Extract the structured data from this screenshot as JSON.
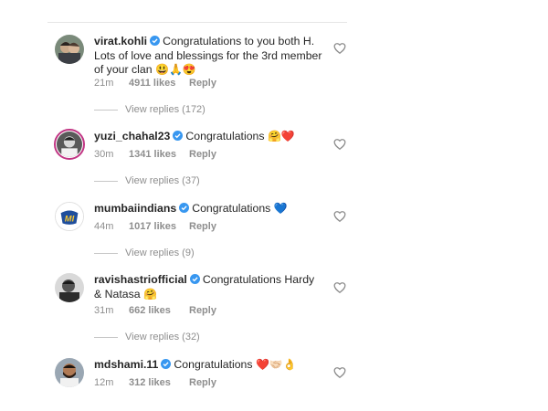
{
  "colors": {
    "accent_verified": "#3897f0",
    "muted": "#8e8e8e",
    "heart_red": "#ed4956",
    "story_ring": "#c13584"
  },
  "comments": [
    {
      "username": "virat.kohli",
      "text": "Congratulations to you both H. Lots of love and blessings for the 3rd member of your clan",
      "emojis": "😃🙏😍",
      "time": "21m",
      "likes": "4911 likes",
      "reply": "Reply",
      "view_replies": "View replies (172)"
    },
    {
      "username": "yuzi_chahal23",
      "text": "Congratulations",
      "emojis": "🤗❤️",
      "time": "30m",
      "likes": "1341 likes",
      "reply": "Reply",
      "view_replies": "View replies (37)"
    },
    {
      "username": "mumbaiindians",
      "text": "Congratulations",
      "emojis": "💙",
      "time": "44m",
      "likes": "1017 likes",
      "reply": "Reply",
      "view_replies": "View replies (9)"
    },
    {
      "username": "ravishastriofficial",
      "text": "Congratulations Hardy & Natasa",
      "emojis": "🤗",
      "time": "31m",
      "likes": "662 likes",
      "reply": "Reply",
      "view_replies": "View replies (32)"
    },
    {
      "username": "mdshami.11",
      "text": "Congratulations",
      "emojis": "❤️🤝🏻👌",
      "time": "12m",
      "likes": "312 likes",
      "reply": "Reply"
    }
  ],
  "icons": {
    "verified": "verified-badge-icon",
    "like": "heart-outline-icon",
    "avatar_logo": "mi-logo-icon"
  },
  "avatar_logo_text": "MI"
}
